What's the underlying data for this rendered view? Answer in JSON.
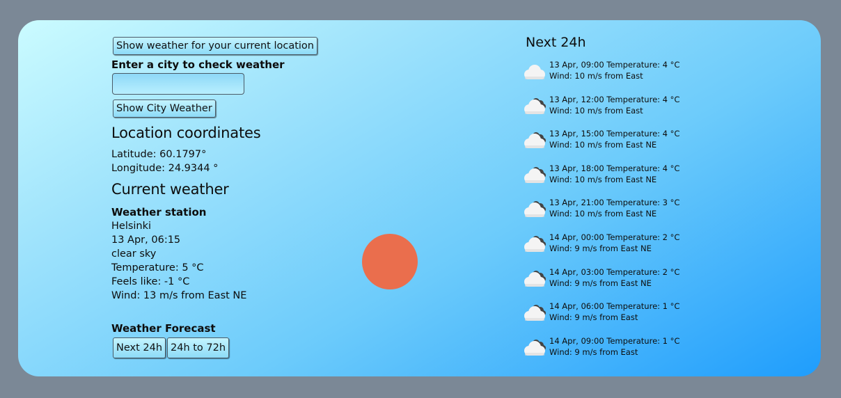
{
  "controls": {
    "location_button": "Show weather for your current location",
    "city_prompt": "Enter a city to check weather",
    "city_input_value": "",
    "city_button": "Show City Weather"
  },
  "coordinates": {
    "heading": "Location coordinates",
    "latitude": "Latitude: 60.1797°",
    "longitude": "Longitude: 24.9344 °"
  },
  "current": {
    "heading": "Current weather",
    "station_heading": "Weather station",
    "city": "Helsinki",
    "datetime": "13 Apr, 06:15",
    "description": "clear sky",
    "temperature": "Temperature: 5 °C",
    "feels_like": "Feels like: -1 °C",
    "wind": "Wind: 13 m/s from East NE",
    "icon": "sun-icon",
    "sun_color": "#ea6e4d"
  },
  "forecast_menu": {
    "heading": "Weather Forecast",
    "next24_button": "Next 24h",
    "range_button": "24h to 72h"
  },
  "forecast": {
    "heading": "Next 24h",
    "items": [
      {
        "line1": "13 Apr, 09:00 Temperature: 4 °C",
        "line2": "Wind: 10 m/s from East",
        "icon": "cloud-icon"
      },
      {
        "line1": "13 Apr, 12:00 Temperature: 4 °C",
        "line2": "Wind: 10 m/s from East",
        "icon": "broken-clouds-icon"
      },
      {
        "line1": "13 Apr, 15:00 Temperature: 4 °C",
        "line2": "Wind: 10 m/s from East NE",
        "icon": "broken-clouds-icon"
      },
      {
        "line1": "13 Apr, 18:00 Temperature: 4 °C",
        "line2": "Wind: 10 m/s from East NE",
        "icon": "broken-clouds-icon"
      },
      {
        "line1": "13 Apr, 21:00 Temperature: 3 °C",
        "line2": "Wind: 10 m/s from East NE",
        "icon": "broken-clouds-icon"
      },
      {
        "line1": "14 Apr, 00:00 Temperature: 2 °C",
        "line2": "Wind: 9 m/s from East NE",
        "icon": "broken-clouds-icon"
      },
      {
        "line1": "14 Apr, 03:00 Temperature: 2 °C",
        "line2": "Wind: 9 m/s from East NE",
        "icon": "broken-clouds-icon"
      },
      {
        "line1": "14 Apr, 06:00 Temperature: 1 °C",
        "line2": "Wind: 9 m/s from East",
        "icon": "broken-clouds-icon"
      },
      {
        "line1": "14 Apr, 09:00 Temperature: 1 °C",
        "line2": "Wind: 9 m/s from East",
        "icon": "broken-clouds-icon"
      }
    ]
  }
}
